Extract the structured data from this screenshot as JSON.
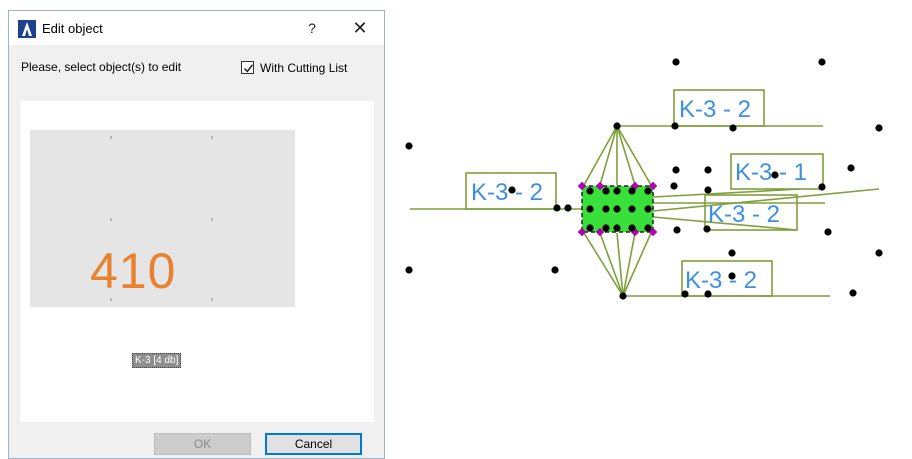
{
  "dialog": {
    "title": "Edit object",
    "help_label": "?",
    "close_label": "✕",
    "prompt": "Please, select object(s) to edit",
    "cutting_list": {
      "label": "With Cutting List",
      "checked": true
    },
    "preview": {
      "number": "410",
      "number_color": "#e9822f",
      "background": "#e5e5e6"
    },
    "selection_label": "K-3 [4 db]",
    "ok_label": "OK",
    "ok_enabled": false,
    "cancel_label": "Cancel"
  },
  "drawing": {
    "label_text_color": "#3d8fe0",
    "line_color": "#7f9f3a",
    "fill_color": "#39e039",
    "handle_color": "#b000b0",
    "labels": [
      {
        "id": "tag-top",
        "text": "K-3 - 2"
      },
      {
        "id": "tag-left",
        "text": "K-3 - 2"
      },
      {
        "id": "tag-right-1",
        "text": "K-3 - 1"
      },
      {
        "id": "tag-right-2",
        "text": "K-3 - 2"
      },
      {
        "id": "tag-bottom",
        "text": "K-3 - 2"
      }
    ]
  }
}
